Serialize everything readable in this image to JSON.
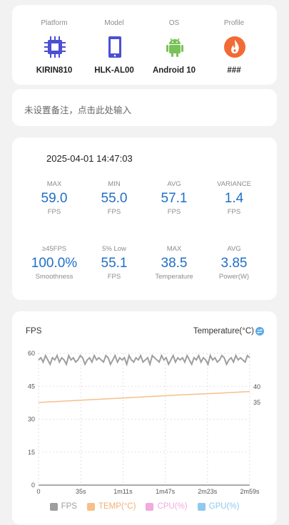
{
  "device": {
    "platform": {
      "label": "Platform",
      "value": "KIRIN810",
      "icon": "chip-icon"
    },
    "model": {
      "label": "Model",
      "value": "HLK-AL00",
      "icon": "phone-icon"
    },
    "os": {
      "label": "OS",
      "value": "Android 10",
      "icon": "android-icon"
    },
    "profile": {
      "label": "Profile",
      "value": "###",
      "icon": "profile-flame-icon"
    }
  },
  "note": {
    "placeholder": "未设置备注，点击此处输入"
  },
  "record": {
    "timestamp": "2025-04-01 14:47:03"
  },
  "stats": [
    {
      "label": "MAX",
      "value": "59.0",
      "unit": "FPS"
    },
    {
      "label": "MIN",
      "value": "55.0",
      "unit": "FPS"
    },
    {
      "label": "AVG",
      "value": "57.1",
      "unit": "FPS"
    },
    {
      "label": "VARIANCE",
      "value": "1.4",
      "unit": "FPS"
    },
    {
      "label": "≥45FPS",
      "value": "100.0%",
      "unit": "Smoothness"
    },
    {
      "label": "5% Low",
      "value": "55.1",
      "unit": "FPS"
    },
    {
      "label": "MAX",
      "value": "38.5",
      "unit": "Temperature"
    },
    {
      "label": "AVG",
      "value": "3.85",
      "unit": "Power(W)"
    }
  ],
  "colors": {
    "accent": "#1f6fc7",
    "fps": "#9e9e9e",
    "temp": "#f5c08a",
    "cpu": "#f3a8e0",
    "gpu": "#8ec9f0"
  },
  "chart_data": {
    "type": "line",
    "left_axis_label": "FPS",
    "right_axis_label": "Temperature(°C)",
    "left_ticks": [
      "60",
      "45",
      "30",
      "15",
      "0"
    ],
    "right_ticks": [
      "40",
      "35"
    ],
    "x_ticks": [
      "0",
      "35s",
      "1m11s",
      "1m47s",
      "2m23s",
      "2m59s"
    ],
    "x_range_seconds": [
      0,
      179
    ],
    "ylim_left": [
      0,
      60
    ],
    "ylim_right": [
      35,
      40
    ],
    "series": [
      {
        "name": "FPS",
        "values": [
          57,
          58,
          56,
          59,
          57,
          55,
          58,
          57,
          59,
          56,
          58,
          57,
          55,
          59,
          57,
          58,
          56,
          57,
          59,
          58,
          55,
          57,
          58,
          56,
          59,
          57,
          58,
          57,
          56,
          59,
          58,
          55,
          57,
          59,
          56,
          58,
          57,
          58,
          55,
          59,
          57,
          56,
          58,
          57,
          59,
          56,
          57,
          58,
          55,
          59,
          58,
          57,
          56,
          59,
          57,
          58,
          55,
          57,
          59,
          56,
          58,
          57,
          58,
          56,
          59,
          57,
          55,
          58,
          57,
          59,
          56,
          58,
          57,
          55,
          59,
          57,
          58,
          56,
          57,
          59,
          58,
          55,
          57,
          58,
          56,
          59,
          57,
          58,
          57,
          56,
          59,
          58
        ]
      },
      {
        "name": "TEMP(°C)",
        "values": [
          35.0,
          35.6,
          36.2,
          36.8,
          37.4,
          37.9,
          38.5
        ]
      },
      {
        "name": "CPU(%)",
        "values": []
      },
      {
        "name": "GPU(%)",
        "values": []
      }
    ]
  }
}
